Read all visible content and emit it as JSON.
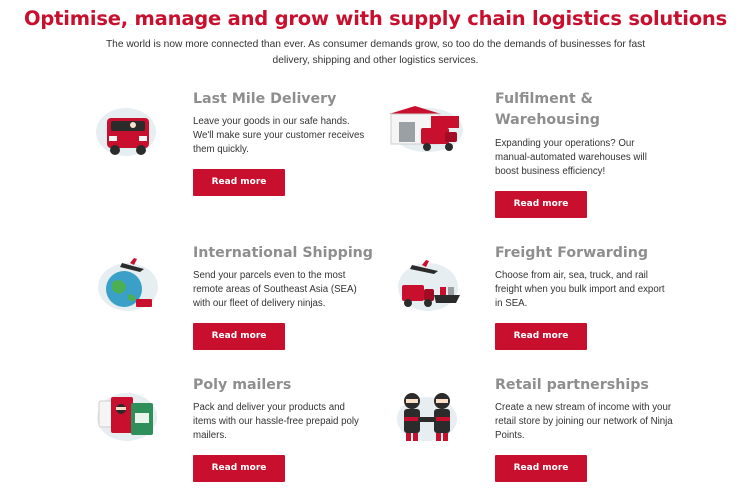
{
  "hero": {
    "title": "Optimise, manage and grow with supply chain logistics solutions",
    "subtitle": "The world is now more connected than ever. As consumer demands grow, so too do the demands of businesses for fast delivery, shipping and other logistics services."
  },
  "services": [
    {
      "title": "Last Mile Delivery",
      "description": "Leave your goods in our safe hands. We'll make sure your customer receives them quickly.",
      "button_label": "Read more",
      "illustration": "delivery-van-icon"
    },
    {
      "title": "Fulfilment & Warehousing",
      "description": "Expanding your operations? Our manual-automated warehouses will boost business efficiency!",
      "button_label": "Read more",
      "illustration": "warehouse-icon"
    },
    {
      "title": "International Shipping",
      "description": "Send your parcels even to the most remote areas of Southeast Asia (SEA) with our fleet of delivery ninjas.",
      "button_label": "Read more",
      "illustration": "globe-plane-icon"
    },
    {
      "title": "Freight Forwarding",
      "description": "Choose from air, sea, truck, and rail freight when you bulk import and export in SEA.",
      "button_label": "Read more",
      "illustration": "freight-icon"
    },
    {
      "title": "Poly mailers",
      "description": "Pack and deliver your products and items with our hassle-free prepaid poly mailers.",
      "button_label": "Read more",
      "illustration": "poly-mailer-icon"
    },
    {
      "title": "Retail partnerships",
      "description": "Create a new stream of income with your retail store by joining our network of Ninja Points.",
      "button_label": "Read more",
      "illustration": "handshake-ninjas-icon"
    }
  ],
  "colors": {
    "brand_red": "#c8102e",
    "heading_gray": "#8e8e8e",
    "text": "#333333"
  }
}
